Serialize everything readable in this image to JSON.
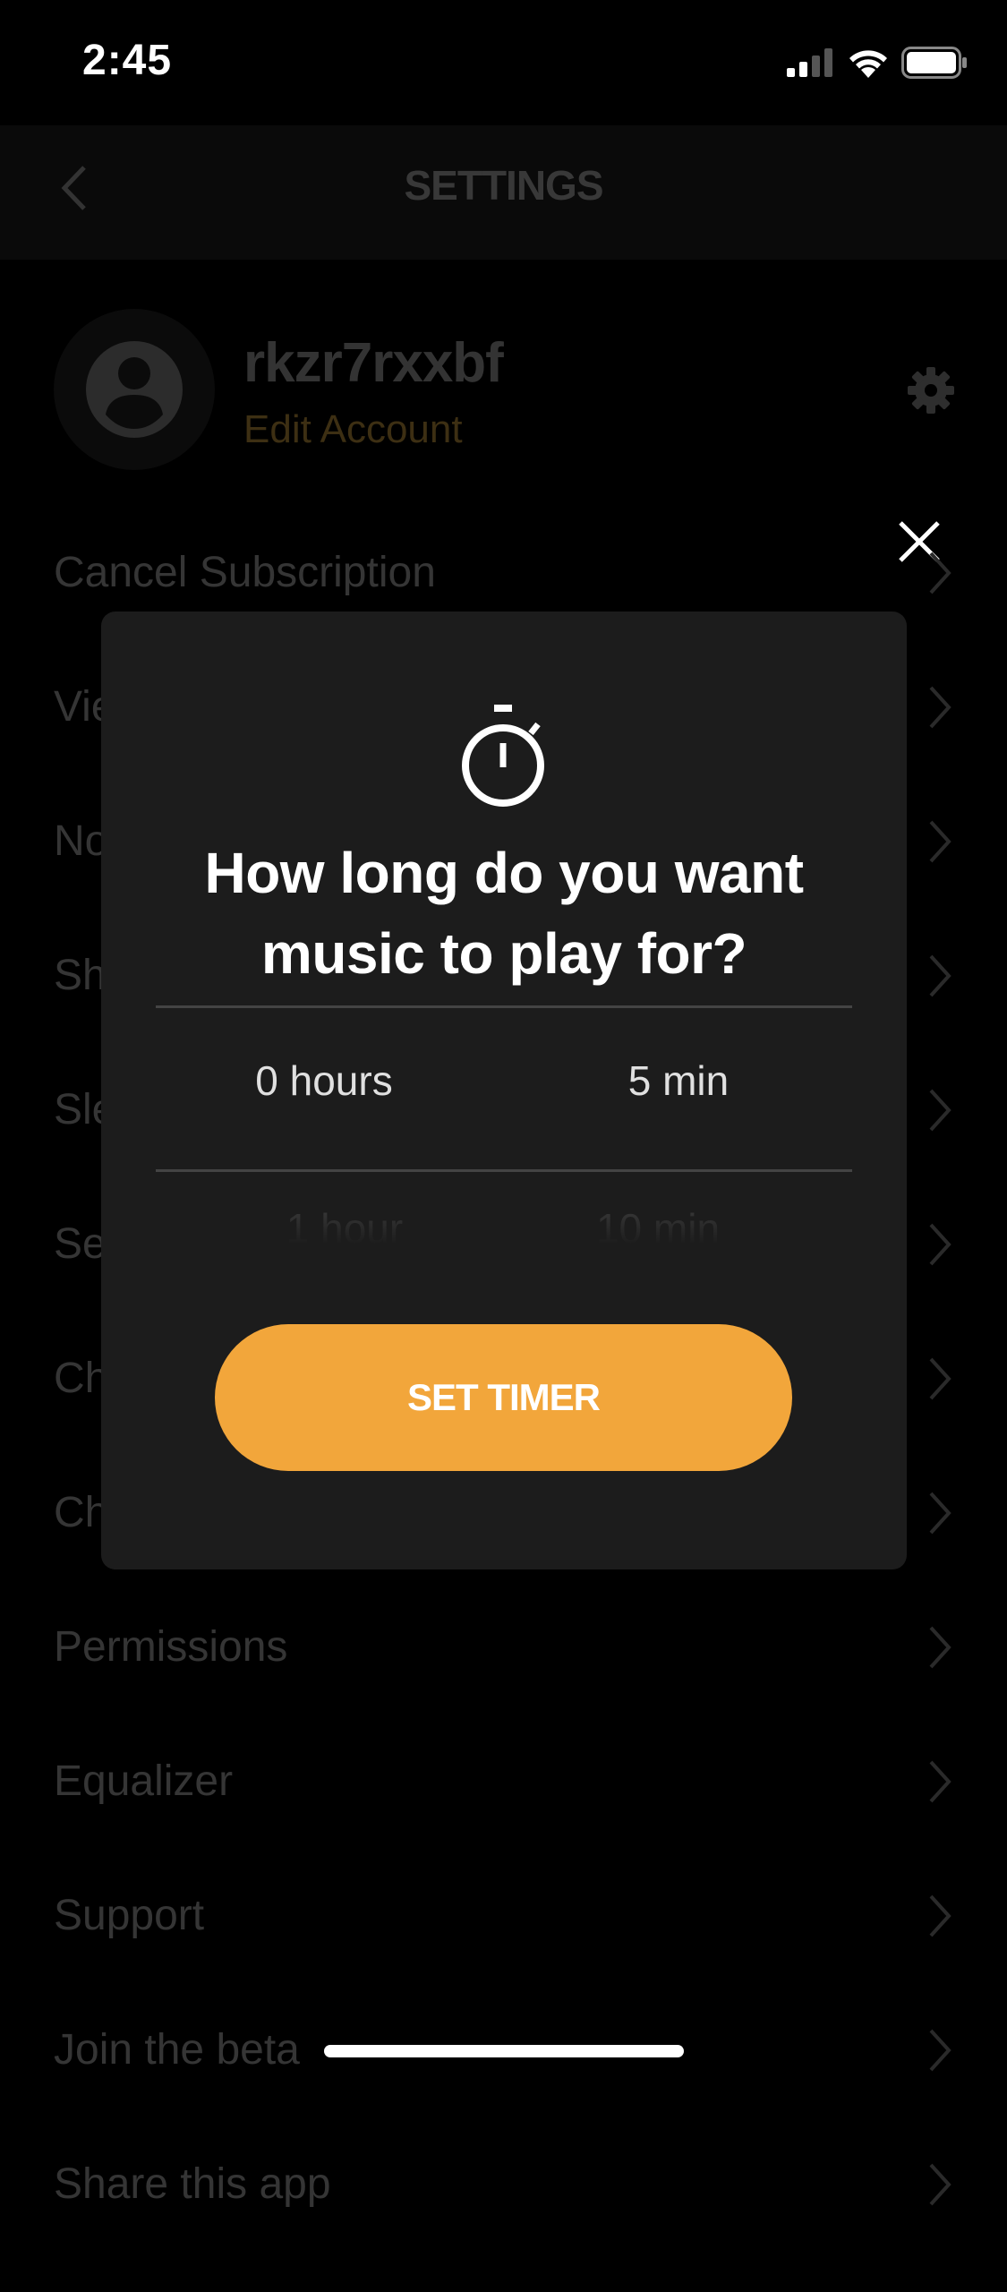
{
  "status_bar": {
    "time": "2:45",
    "icons": [
      "signal-icon",
      "wifi-icon",
      "battery-icon"
    ]
  },
  "header": {
    "title": "SETTINGS",
    "back_icon": "chevron-left-icon"
  },
  "profile": {
    "username": "rkzr7rxxbf",
    "edit_label": "Edit Account",
    "avatar_icon": "user-avatar-icon",
    "settings_icon": "gear-icon"
  },
  "settings_list": [
    {
      "label": "Cancel Subscription"
    },
    {
      "label": "Vie"
    },
    {
      "label": "No"
    },
    {
      "label": "Sh"
    },
    {
      "label": "Sle"
    },
    {
      "label": "Se"
    },
    {
      "label": "Ch"
    },
    {
      "label": "Ch"
    },
    {
      "label": "Permissions"
    },
    {
      "label": "Equalizer"
    },
    {
      "label": "Support"
    },
    {
      "label": "Join the beta"
    },
    {
      "label": "Share this app"
    }
  ],
  "modal": {
    "close_icon": "close-icon",
    "icon": "stopwatch-icon",
    "title_line1": "How long do you want",
    "title_line2": "music to play for?",
    "picker": {
      "hours": {
        "selected": "0 hours",
        "next": "1 hour"
      },
      "minutes": {
        "selected": "5 min",
        "next": "10 min"
      }
    },
    "button_label": "SET TIMER"
  },
  "colors": {
    "accent": "#f2a63b",
    "modal_bg": "#1c1c1c",
    "background": "#000000",
    "edit_account_dimmed": "#3d2f13"
  }
}
